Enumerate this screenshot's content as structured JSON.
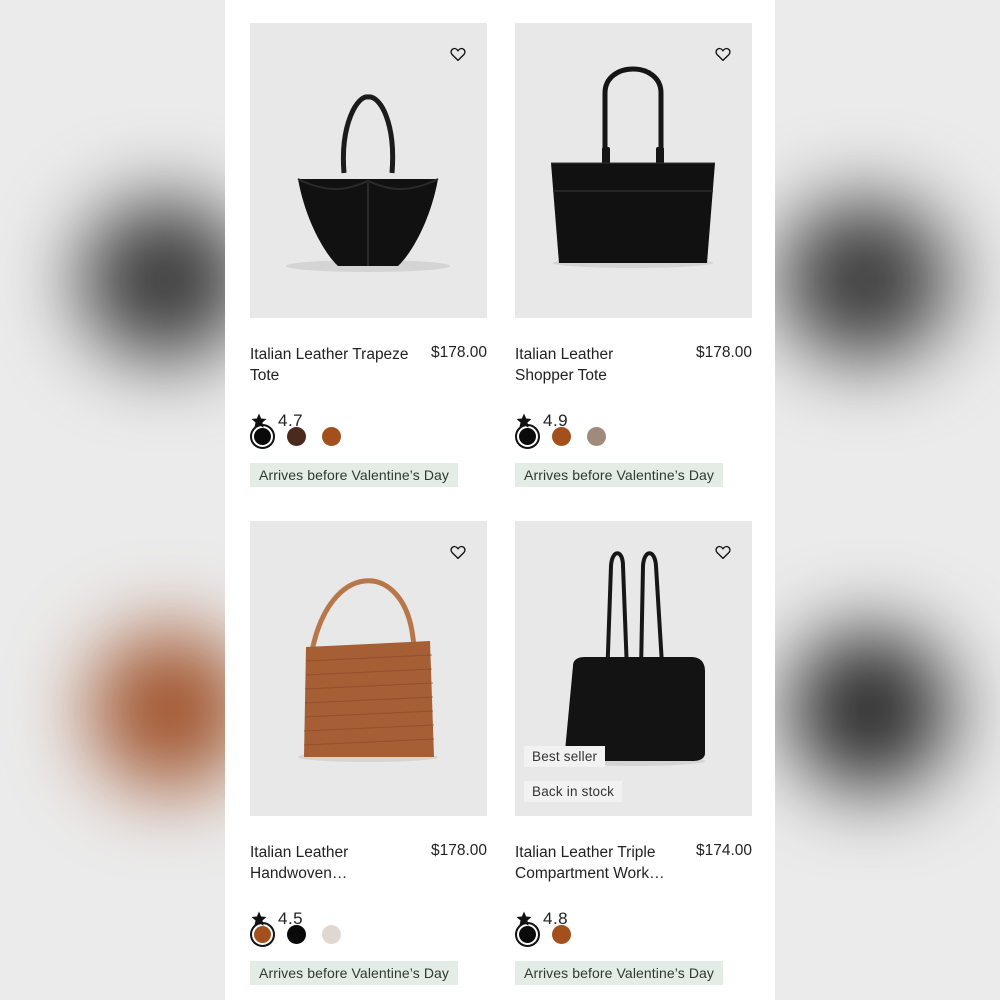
{
  "products": [
    {
      "name": "Italian Leather Trapeze Tote",
      "price": "$178.00",
      "rating": "4.7",
      "delivery": "Arrives before Valentine’s Day",
      "swatches": [
        "#0a0a0a",
        "#4a2a1c",
        "#a3501d"
      ],
      "selected_swatch": 0
    },
    {
      "name": "Italian Leather Shopper Tote",
      "price": "$178.00",
      "rating": "4.9",
      "delivery": "Arrives before Valentine’s Day",
      "swatches": [
        "#0a0a0a",
        "#a3501d",
        "#a08a7c"
      ],
      "selected_swatch": 0
    },
    {
      "name": "Italian Leather Handwoven…",
      "price": "$178.00",
      "rating": "4.5",
      "delivery": "Arrives before Valentine’s Day",
      "swatches": [
        "#a3501d",
        "#0a0a0a",
        "#e0d7d0"
      ],
      "selected_swatch": 0
    },
    {
      "name": "Italian Leather Triple Compartment Work…",
      "price": "$174.00",
      "rating": "4.8",
      "delivery": "Arrives before Valentine’s Day",
      "swatches": [
        "#0a0a0a",
        "#a3501d"
      ],
      "selected_swatch": 0,
      "badges": [
        "Best seller",
        "Back in stock"
      ]
    }
  ],
  "colors": {
    "image_bg": "#e8e8e8",
    "delivery_bg": "#e3ede5",
    "text": "#222222"
  },
  "icons": {
    "favorite": "heart-outline-icon",
    "rating": "star-icon"
  }
}
